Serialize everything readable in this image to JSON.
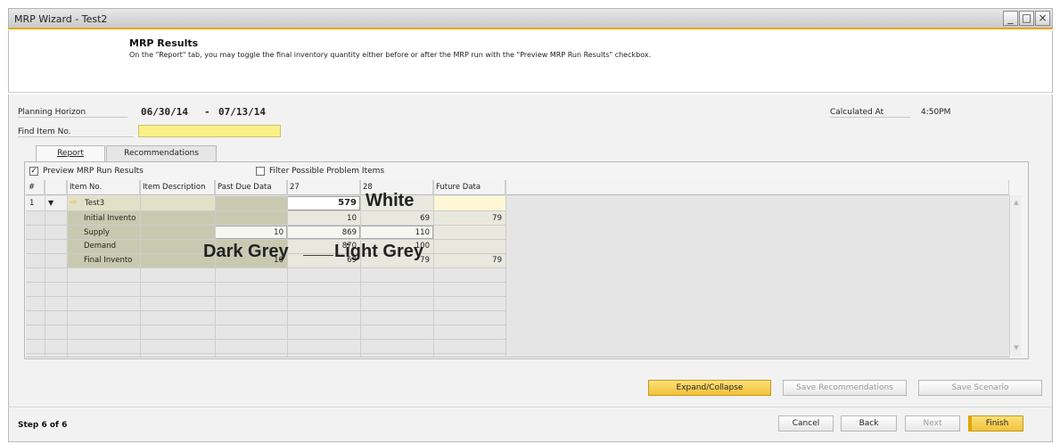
{
  "window": {
    "title": "MRP Wizard - Test2",
    "controls": {
      "minimize": "_",
      "maximize": "□",
      "close": "×"
    }
  },
  "banner": {
    "heading": "MRP Results",
    "subtext": "On the \"Report\" tab, you may toggle the final inventory quantity either before or after the MRP run with the \"Preview MRP Run Results\" checkbox."
  },
  "planning": {
    "label": "Planning Horizon",
    "from": "06/30/14",
    "dash": "-",
    "to": "07/13/14",
    "calc_label": "Calculated At",
    "calc_value": "4:50PM"
  },
  "find": {
    "label": "Find Item No.",
    "value": ""
  },
  "tabs": [
    {
      "label": "Report",
      "active": true
    },
    {
      "label": "Recommendations",
      "active": false
    }
  ],
  "options": {
    "preview": {
      "label": "Preview MRP Run Results",
      "checked": true
    },
    "filter": {
      "label": "Filter Possible Problem Items",
      "checked": false
    }
  },
  "grid": {
    "headers": [
      "#",
      "",
      "Item No.",
      "Item Description",
      "Past Due Data",
      "27",
      "28",
      "Future Data"
    ],
    "item_row": {
      "num": "1",
      "item": "Test3",
      "col27": "579"
    },
    "detail_rows": [
      {
        "label": "Initial Invento",
        "past": "",
        "c27": "10",
        "c28": "69",
        "future": "79"
      },
      {
        "label": "Supply",
        "past": "10",
        "c27": "869",
        "c28": "110",
        "future": ""
      },
      {
        "label": "Demand",
        "past": "",
        "c27": "870",
        "c28": "100",
        "future": ""
      },
      {
        "label": "Final Invento",
        "past": "10",
        "c27": "69",
        "c28": "79",
        "future": "79"
      }
    ]
  },
  "annotations": {
    "white": "White",
    "dark_grey": "Dark Grey",
    "light_grey": "Light Grey"
  },
  "buttons": {
    "expand_collapse": "Expand/Collapse",
    "save_recommendations": "Save Recommendations",
    "save_scenario": "Save Scenario",
    "cancel": "Cancel",
    "back": "Back",
    "next": "Next",
    "finish": "Finish"
  },
  "step": "Step 6 of 6",
  "colors": {
    "accent": "#f2c23a",
    "find_input": "#fbf08a",
    "dark_grey_cells": "#c9c9b1",
    "light_grey_cells": "#e9e8de",
    "white_cells": "#ffffff",
    "item_row_yellow": "#fdf7d6"
  }
}
